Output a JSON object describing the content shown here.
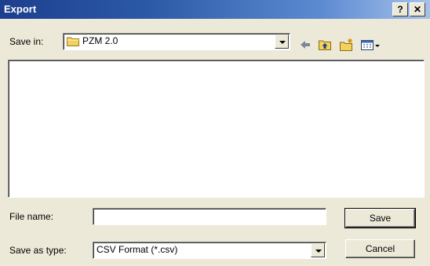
{
  "window": {
    "title": "Export"
  },
  "titlebar": {
    "help_label": "?",
    "close_label": "✕"
  },
  "save_in": {
    "label": "Save in:",
    "value": "PZM 2.0"
  },
  "toolbar": {
    "icons": [
      "back-arrow-icon",
      "up-folder-icon",
      "new-folder-icon",
      "view-menu-icon"
    ]
  },
  "file_name": {
    "label": "File name:",
    "value": ""
  },
  "save_as_type": {
    "label": "Save as type:",
    "value": "CSV Format (*.csv)"
  },
  "buttons": {
    "save": "Save",
    "cancel": "Cancel"
  },
  "colors": {
    "title_start": "#1c3f8e",
    "title_end": "#a6c2ea",
    "face": "#ece9d8",
    "folder": "#f4d15c"
  }
}
